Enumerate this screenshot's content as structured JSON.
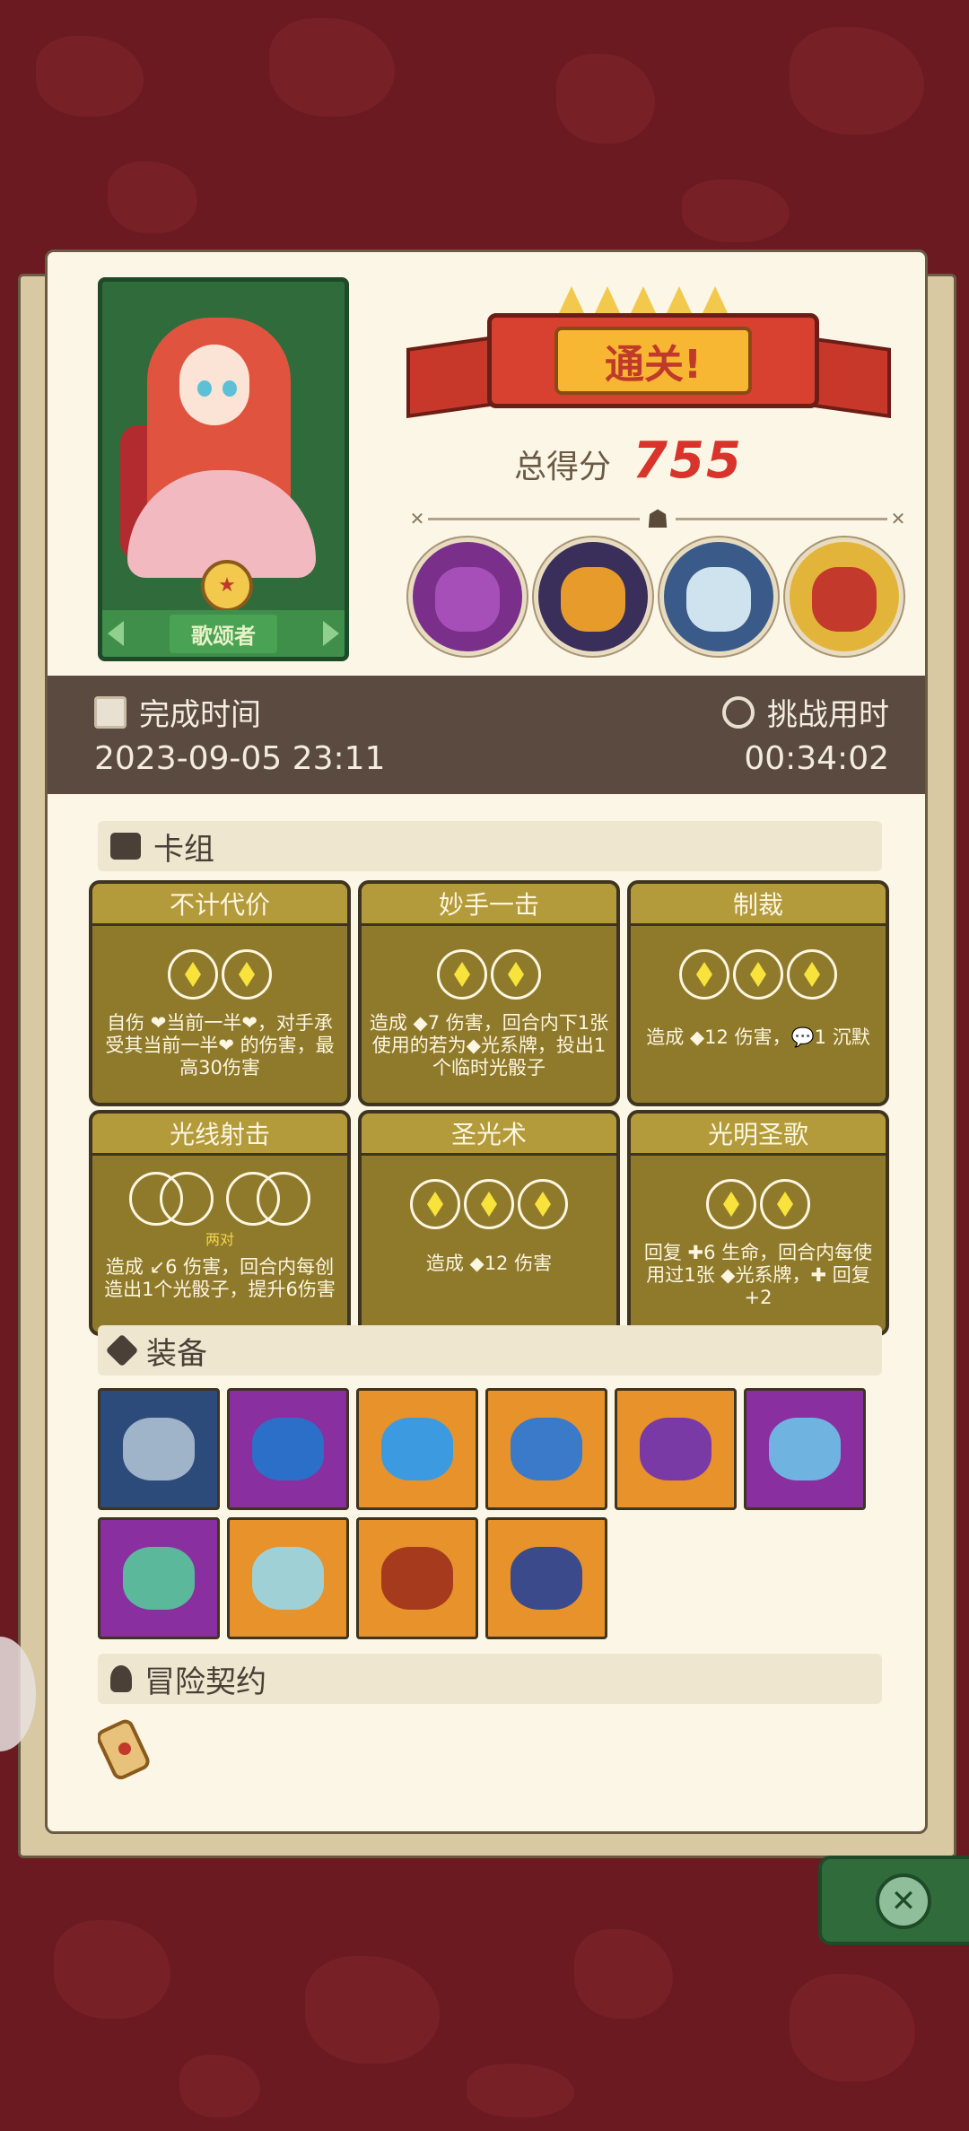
{
  "result": {
    "clear_title": "通关!",
    "score_label": "总得分",
    "score_value": "755"
  },
  "hero": {
    "role_name": "歌颂者"
  },
  "bosses": [
    {
      "name": "purple-monster",
      "color": "#a64fb8"
    },
    {
      "name": "golden-warrior",
      "color": "#e69b2b"
    },
    {
      "name": "snow-beast",
      "color": "#cfe3ee"
    },
    {
      "name": "red-samurai",
      "color": "#c33a2c"
    }
  ],
  "times": {
    "finish_label": "完成时间",
    "finish_value": "2023-09-05 23:11",
    "challenge_label": "挑战用时",
    "challenge_value": "00:34:02"
  },
  "sections": {
    "deck_title": "卡组",
    "equipment_title": "装备",
    "contract_title": "冒险契约"
  },
  "deck": [
    {
      "name": "不计代价",
      "cost": 2,
      "desc": "自伤 ❤当前一半❤，对手承受其当前一半❤ 的伤害，最高30伤害"
    },
    {
      "name": "妙手一击",
      "cost": 2,
      "desc": "造成 ◆7 伤害，回合内下1张使用的若为◆光系牌，投出1个临时光骰子"
    },
    {
      "name": "制裁",
      "cost": 3,
      "desc": "造成 ◆12 伤害，💬1 沉默"
    },
    {
      "name": "光线射击",
      "cost": 0,
      "note": "两对",
      "desc": "造成 ↙6 伤害，回合内每创造出1个光骰子，提升6伤害"
    },
    {
      "name": "圣光术",
      "cost": 3,
      "desc": "造成 ◆12 伤害"
    },
    {
      "name": "光明圣歌",
      "cost": 2,
      "desc": "回复 ✚6 生命，回合内每使用过1张 ◆光系牌，✚ 回复+2"
    }
  ],
  "equipment": [
    {
      "name": "scythe-blade",
      "bg": "#2c4a7a",
      "color": "#9fb3c9"
    },
    {
      "name": "blue-flame",
      "bg": "#8a2fa0",
      "color": "#2b6fc9"
    },
    {
      "name": "water-orb",
      "bg": "#e8922b",
      "color": "#3c9be0"
    },
    {
      "name": "spiked-gem",
      "bg": "#e8922b",
      "color": "#3a7ac9"
    },
    {
      "name": "purple-hood",
      "bg": "#e8922b",
      "color": "#7a3aa6"
    },
    {
      "name": "crystal-ring",
      "bg": "#8a2fa0",
      "color": "#6fb3e0"
    },
    {
      "name": "jade-shield",
      "bg": "#8a2fa0",
      "color": "#5cb89a"
    },
    {
      "name": "stone-urn",
      "bg": "#e8922b",
      "color": "#9fd0d6"
    },
    {
      "name": "leather-helm",
      "bg": "#e8922b",
      "color": "#a63a1c"
    },
    {
      "name": "plague-mask",
      "bg": "#e8922b",
      "color": "#3a4a8a"
    }
  ],
  "close_icon": "close-icon"
}
